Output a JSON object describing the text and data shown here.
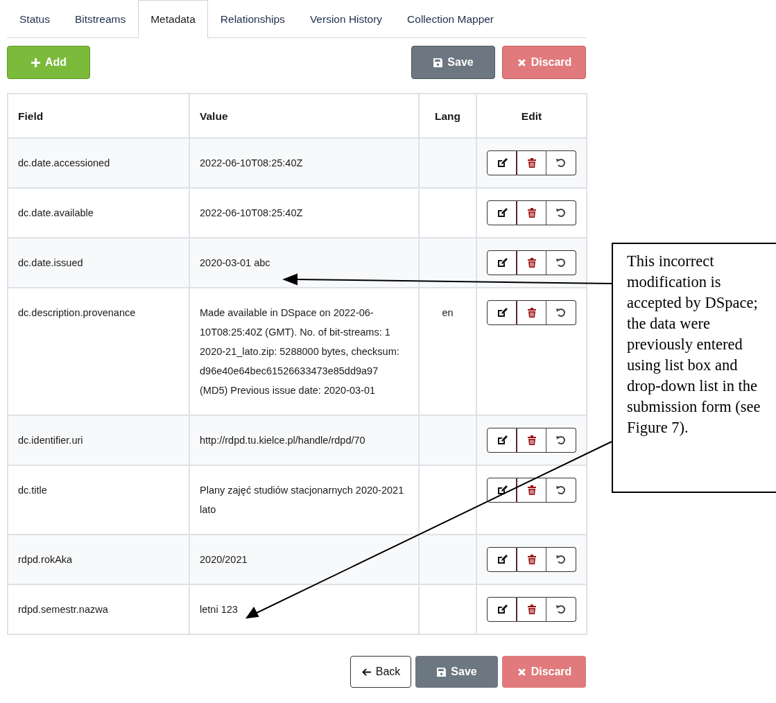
{
  "tabs": [
    {
      "label": "Status",
      "selected": false
    },
    {
      "label": "Bitstreams",
      "selected": false
    },
    {
      "label": "Metadata",
      "selected": true
    },
    {
      "label": "Relationships",
      "selected": false
    },
    {
      "label": "Version History",
      "selected": false
    },
    {
      "label": "Collection Mapper",
      "selected": false
    }
  ],
  "toolbar": [
    {
      "kind": "add",
      "label": "Add"
    },
    {
      "kind": "save",
      "label": "Save"
    },
    {
      "kind": "discard",
      "label": "Discard"
    }
  ],
  "table": {
    "columns": [
      "Field",
      "Value",
      "Lang",
      "Edit"
    ],
    "rows": [
      {
        "field": "dc.date.accessioned",
        "value": "2022-06-10T08:25:40Z"
      },
      {
        "field": "dc.date.available",
        "value": "2022-06-10T08:25:40Z"
      },
      {
        "field": "dc.date.issued",
        "value": "2020-03-01 abc"
      },
      {
        "field": "dc.description.provenance",
        "value": "Made available in DSpace on 2022-06-10T08:25:40Z (GMT). No. of bit-streams: 1 2020-21_lato.zip: 5288000 bytes, checksum: d96e40e64bec61526633473e85dd9a97 (MD5) Previous issue date: 2020-03-01",
        "lang": "en"
      },
      {
        "field": "dc.identifier.uri",
        "value": "http://rdpd.tu.kielce.pl/handle/rdpd/70"
      },
      {
        "field": "dc.title",
        "value": "Plany zajęć studiów stacjonarnych 2020-2021 lato"
      },
      {
        "field": "rdpd.rokAka",
        "value": "2020/2021"
      },
      {
        "field": "rdpd.semestr.nazwa",
        "value": "letni 123"
      }
    ]
  },
  "footer_buttons": [
    {
      "kind": "back",
      "label": "Back"
    },
    {
      "kind": "save",
      "label": "Save"
    },
    {
      "kind": "discard",
      "label": "Discard"
    }
  ],
  "callout": {
    "text": "This incorrect modification is accepted by DSpace; the data were previously entered using list box and drop-down list in the submission form (see Figure 7)."
  }
}
